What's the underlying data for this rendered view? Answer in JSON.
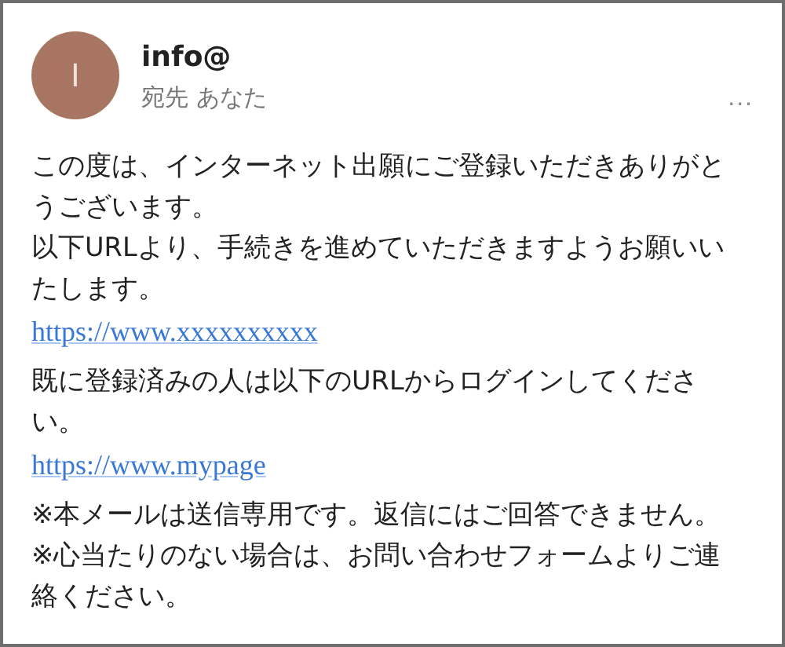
{
  "sender": {
    "avatar_letter": "I",
    "name": "info@",
    "recipient": "宛先 あなた",
    "menu": "..."
  },
  "body": [
    {
      "kind": "text",
      "text": "この度は、インターネット出願にご登録いただきありがとうございます。"
    },
    {
      "kind": "text",
      "text": "以下URLより、手続きを進めていただきますようお願いいたします。"
    },
    {
      "kind": "link",
      "text": "https://www.xxxxxxxxxx"
    },
    {
      "kind": "text",
      "text": " 既に登録済みの人は以下のURLからログインしてください。"
    },
    {
      "kind": "link",
      "text": "https://www.mypage"
    },
    {
      "kind": "note",
      "text": "※本メールは送信専用です。返信にはご回答できません。"
    },
    {
      "kind": "note",
      "text": "※心当たりのない場合は、お問い合わせフォームよりご連絡ください。"
    }
  ]
}
